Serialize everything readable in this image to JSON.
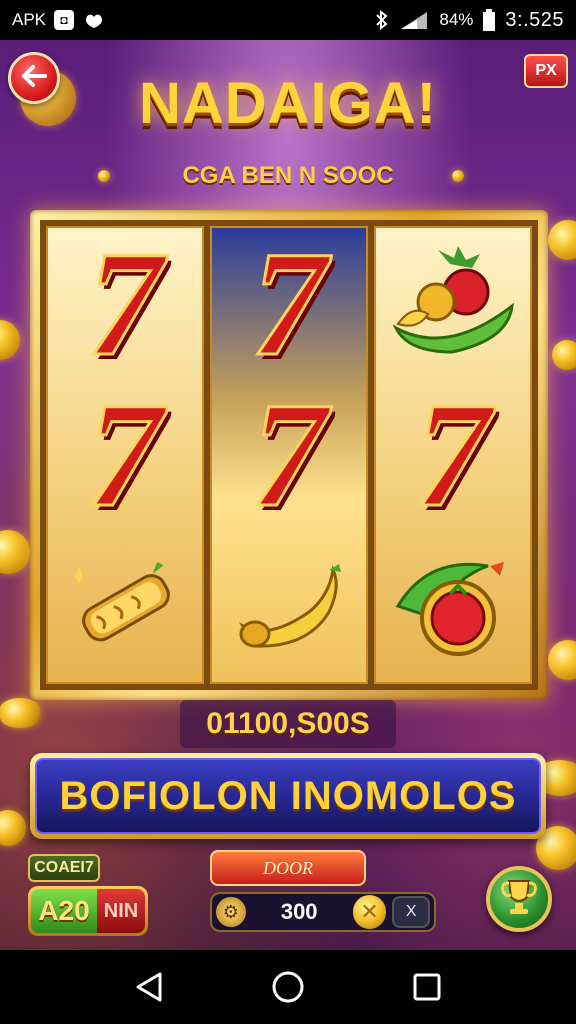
{
  "status_bar": {
    "app_label": "APK",
    "battery": "84%",
    "time": "3:.525"
  },
  "game": {
    "top_right_label": "PX",
    "title": "NADAIGA!",
    "subtitle": "CGA BEN N SOOC",
    "reels": [
      [
        "seven-symbol",
        "seven-symbol",
        "gold-scroll-symbol"
      ],
      [
        "seven-symbol",
        "seven-symbol",
        "gold-banana-symbol"
      ],
      [
        "fruit-basket-symbol",
        "seven-symbol",
        "tomato-cucumber-symbol"
      ]
    ],
    "seven_glyph": "7",
    "counter": "01100,S00S",
    "banner_label": "BOFIOLON INOMOLOS",
    "bet_label": "COAEI7",
    "bet_value": "A20",
    "bet_suffix": "NIN",
    "door_label": "DOOR",
    "credit_value": "300",
    "x_label": "X"
  },
  "colors": {
    "title_gold": "#ffd33a",
    "reel_frame": "#e3a52a",
    "banner_blue": "#24248a",
    "seven_red": "#d11a1a"
  }
}
